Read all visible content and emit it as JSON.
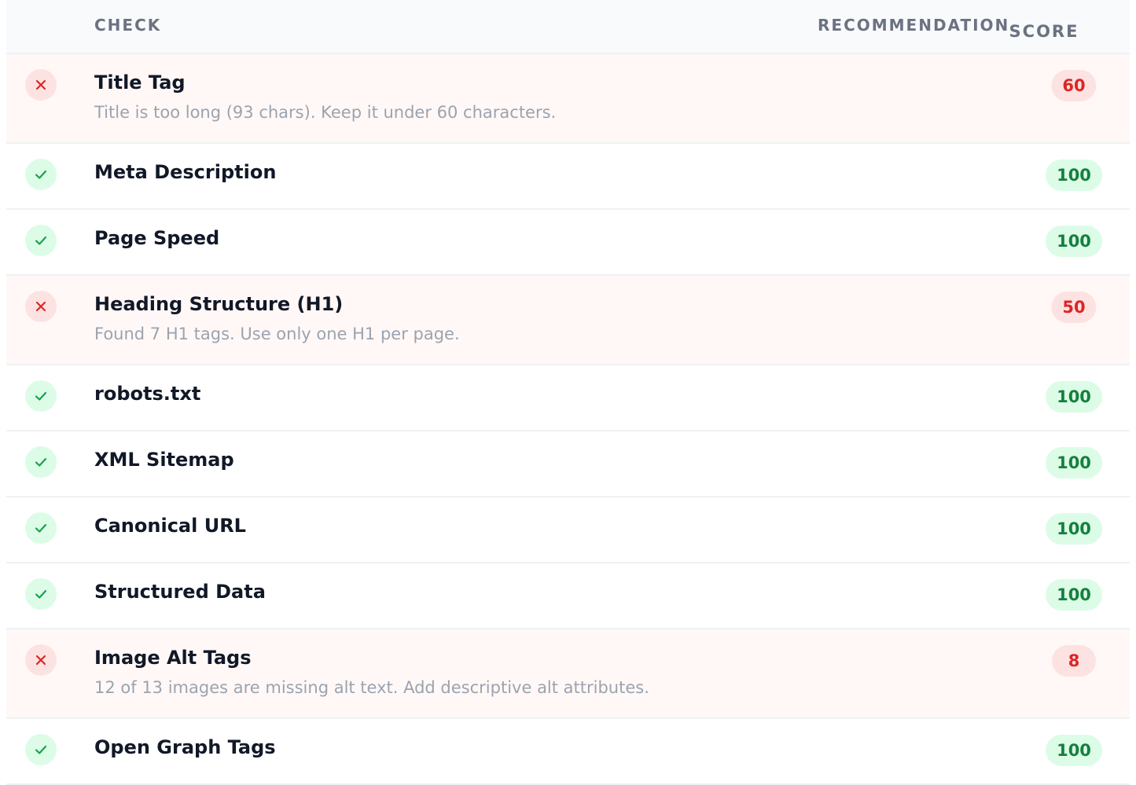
{
  "header": {
    "check": "CHECK",
    "recommendation": "RECOMMENDATION",
    "score": "SCORE"
  },
  "colors": {
    "pass": "#15803d",
    "pass_bg": "#dcfce7",
    "fail": "#dc2626",
    "fail_bg": "#fde2e2",
    "fail_row_bg": "#fff8f7"
  },
  "rows": [
    {
      "status": "fail",
      "icon": "x-icon",
      "name": "Title Tag",
      "description": "Title is too long (93 chars). Keep it under 60 characters.",
      "score": "60"
    },
    {
      "status": "pass",
      "icon": "check-icon",
      "name": "Meta Description",
      "description": "",
      "score": "100"
    },
    {
      "status": "pass",
      "icon": "check-icon",
      "name": "Page Speed",
      "description": "",
      "score": "100"
    },
    {
      "status": "fail",
      "icon": "x-icon",
      "name": "Heading Structure (H1)",
      "description": "Found 7 H1 tags. Use only one H1 per page.",
      "score": "50"
    },
    {
      "status": "pass",
      "icon": "check-icon",
      "name": "robots.txt",
      "description": "",
      "score": "100"
    },
    {
      "status": "pass",
      "icon": "check-icon",
      "name": "XML Sitemap",
      "description": "",
      "score": "100"
    },
    {
      "status": "pass",
      "icon": "check-icon",
      "name": "Canonical URL",
      "description": "",
      "score": "100"
    },
    {
      "status": "pass",
      "icon": "check-icon",
      "name": "Structured Data",
      "description": "",
      "score": "100"
    },
    {
      "status": "fail",
      "icon": "x-icon",
      "name": "Image Alt Tags",
      "description": "12 of 13 images are missing alt text. Add descriptive alt attributes.",
      "score": "8"
    },
    {
      "status": "pass",
      "icon": "check-icon",
      "name": "Open Graph Tags",
      "description": "",
      "score": "100"
    }
  ]
}
